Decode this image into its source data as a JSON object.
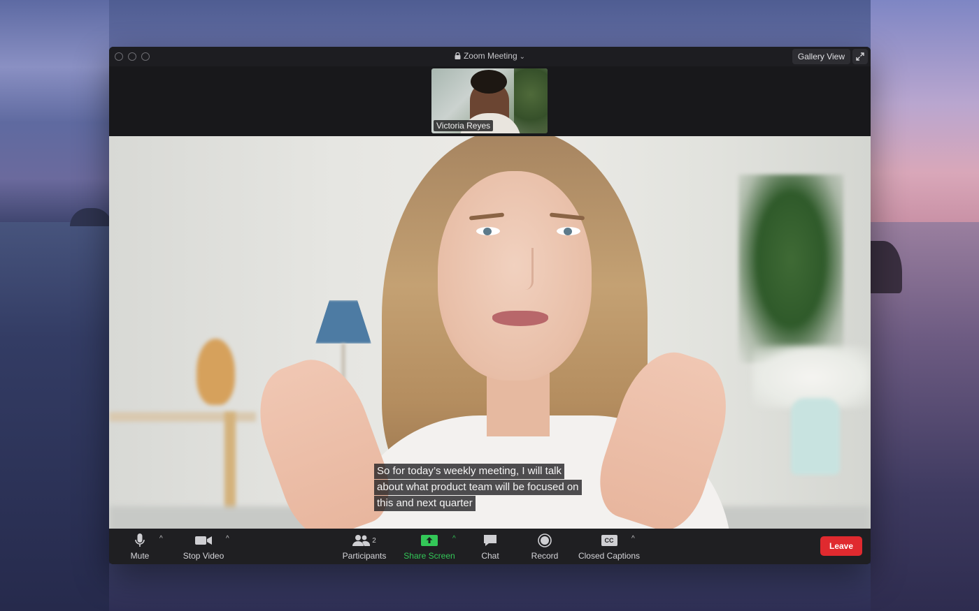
{
  "window": {
    "title": "Zoom Meeting",
    "gallery_view_label": "Gallery View"
  },
  "thumbnail": {
    "participant_name": "Victoria Reyes"
  },
  "captions": {
    "lines": [
      "So for today’s weekly meeting, I will talk",
      "about what product team will be focused on",
      "this and next quarter"
    ]
  },
  "toolbar": {
    "mute_label": "Mute",
    "stop_video_label": "Stop Video",
    "participants_label": "Participants",
    "participants_count": "2",
    "share_screen_label": "Share Screen",
    "chat_label": "Chat",
    "record_label": "Record",
    "closed_captions_label": "Closed Captions",
    "cc_icon_text": "CC",
    "leave_label": "Leave"
  },
  "colors": {
    "accent_green": "#33c758",
    "leave_red": "#e02a2f"
  }
}
